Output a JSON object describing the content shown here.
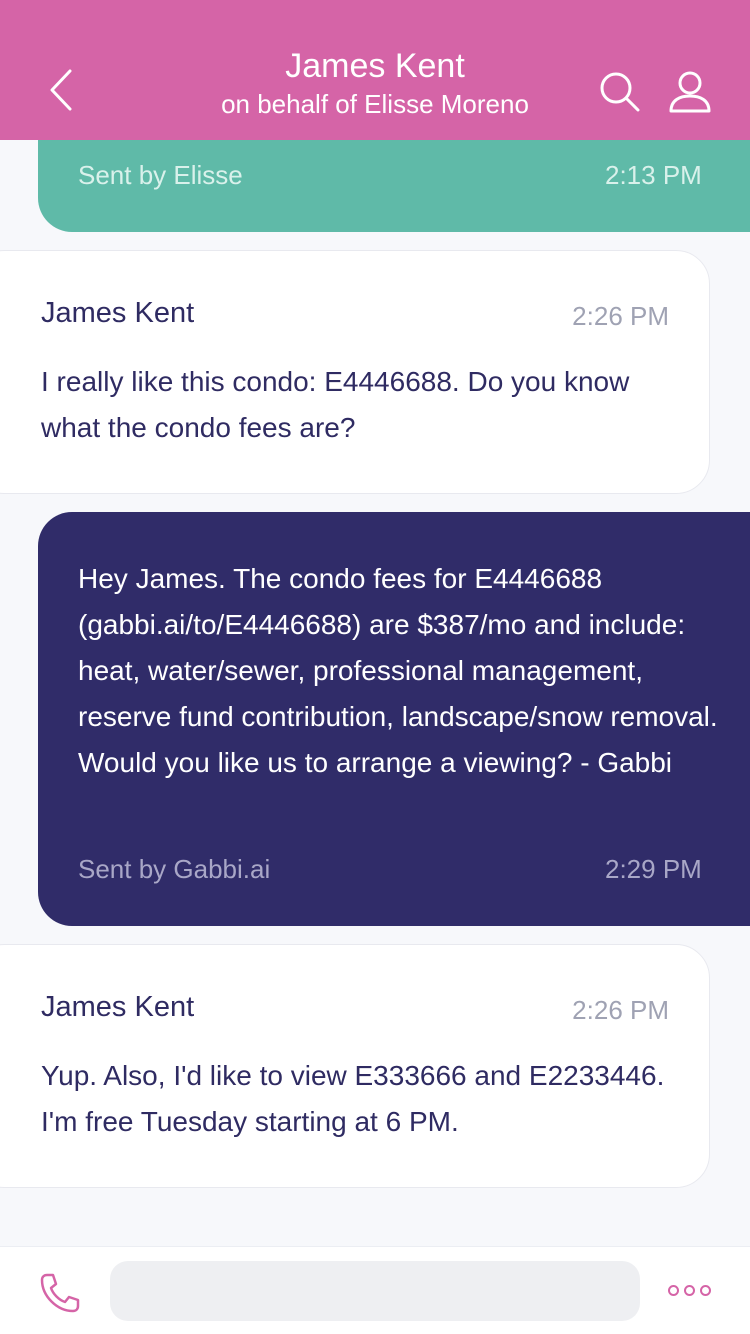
{
  "header": {
    "title": "James Kent",
    "subtitle": "on behalf of Elisse Moreno",
    "color": "#d564a7",
    "icons": [
      "chevron-left-icon",
      "search-icon",
      "user-icon"
    ]
  },
  "messages": [
    {
      "type": "outgoing",
      "color": "#5fbaa8",
      "sent_by": "Sent by Elisse",
      "time": "2:13 PM"
    },
    {
      "type": "incoming",
      "sender": "James Kent",
      "time": "2:26 PM",
      "text": "I really like this condo: E4446688. Do you know what the condo fees are?"
    },
    {
      "type": "outgoing",
      "color": "#302c69",
      "text": "Hey James. The condo fees for E4446688 (gabbi.ai/to/E4446688) are $387/mo and include: heat, water/sewer, professional management, reserve fund contribution, landscape/snow removal. Would you like us to arrange a viewing? - Gabbi",
      "sent_by": "Sent by Gabbi.ai",
      "time": "2:29 PM"
    },
    {
      "type": "incoming",
      "sender": "James Kent",
      "time": "2:26 PM",
      "text": "Yup. Also, I'd like to view E333666 and E2233446. I'm free Tuesday starting at 6 PM."
    }
  ],
  "composer": {
    "value": "",
    "placeholder": "",
    "icons": [
      "phone-icon",
      "more-options-icon"
    ]
  }
}
